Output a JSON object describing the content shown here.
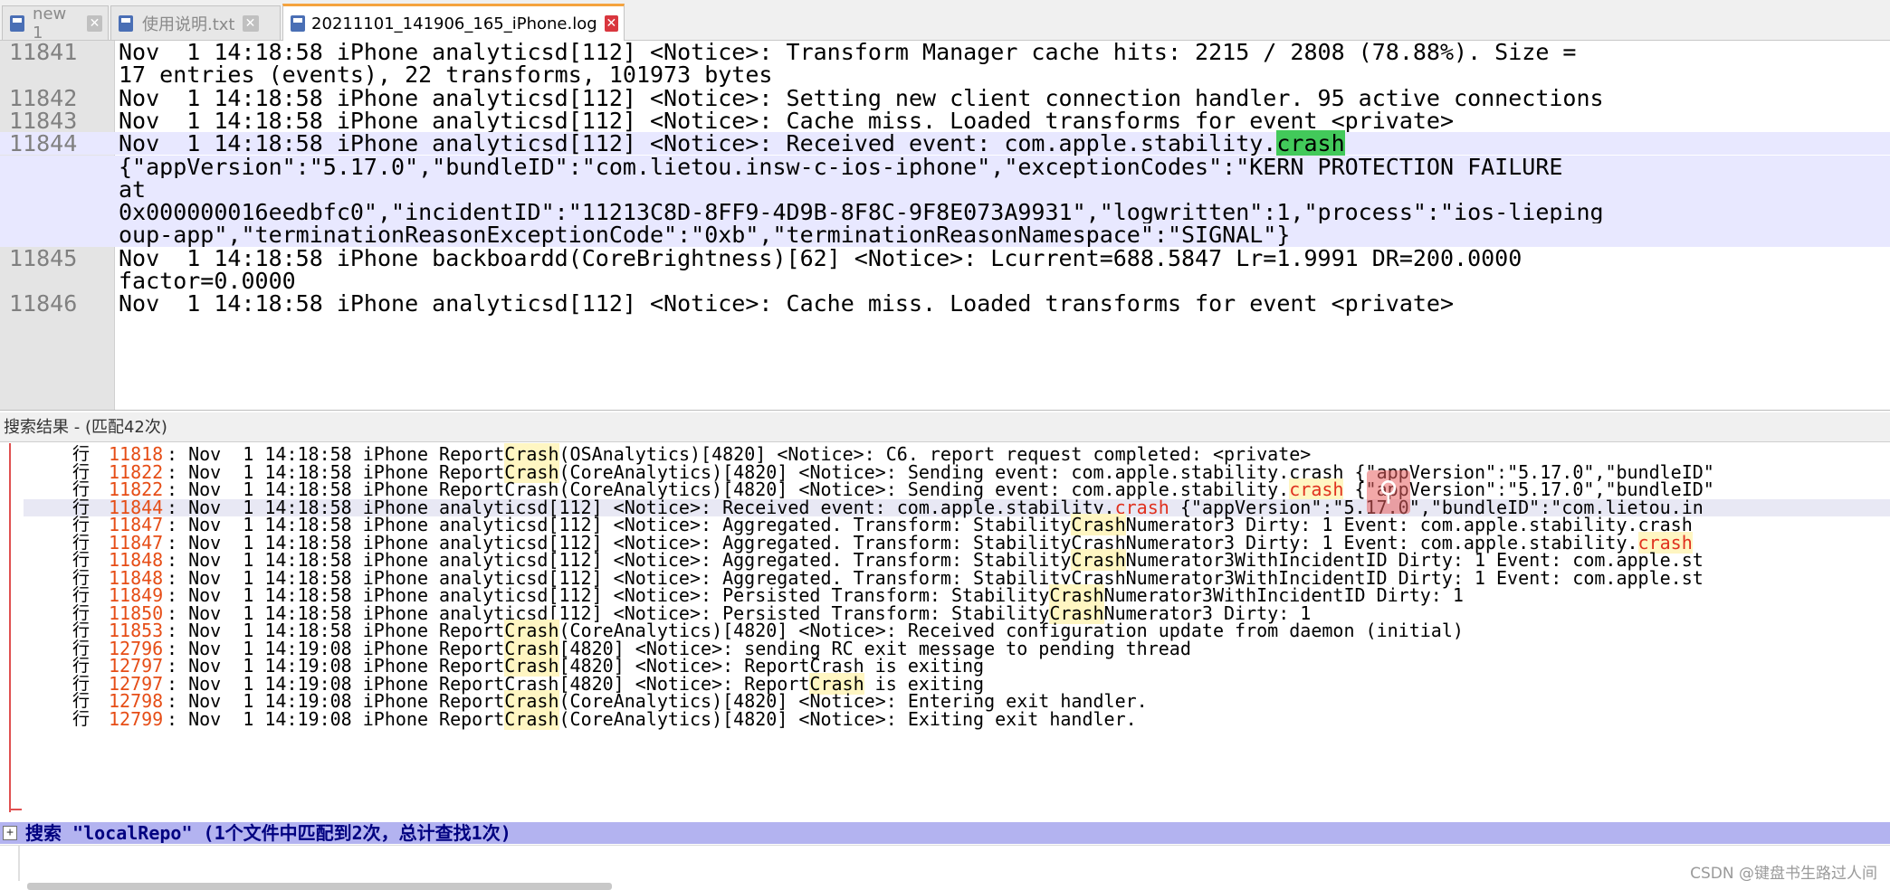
{
  "tabs": [
    {
      "label": "new 1",
      "icon": "save-disk-icon",
      "color": "#4a6fb5",
      "active": false
    },
    {
      "label": "使用说明.txt",
      "icon": "save-disk-icon",
      "color": "#4a6fb5",
      "active": false
    },
    {
      "label": "20211101_141906_165_iPhone.log",
      "icon": "save-disk-icon",
      "color": "#4a6fb5",
      "active": true
    }
  ],
  "editor": {
    "lines": [
      {
        "num": "11841",
        "text": "Nov  1 14:18:58 iPhone analyticsd[112] <Notice>: Transform Manager cache hits: 2215 / 2808 (78.88%). Size ="
      },
      {
        "num": "",
        "text": "17 entries (events), 22 transforms, 101973 bytes"
      },
      {
        "num": "11842",
        "text": "Nov  1 14:18:58 iPhone analyticsd[112] <Notice>: Setting new client connection handler. 95 active connections"
      },
      {
        "num": "11843",
        "text": "Nov  1 14:18:58 iPhone analyticsd[112] <Notice>: Cache miss. Loaded transforms for event <private>"
      },
      {
        "num": "11844",
        "text": "Nov  1 14:18:58 iPhone analyticsd[112] <Notice>: Received event: com.apple.stability.",
        "mark": "crash",
        "highlight": true
      },
      {
        "num": "",
        "text": "{\"appVersion\":\"5.17.0\",\"bundleID\":\"com.lietou.insw-c-ios-iphone\",\"exceptionCodes\":\"KERN_PROTECTION_FAILURE",
        "highlight": true
      },
      {
        "num": "",
        "text": "at",
        "highlight": true
      },
      {
        "num": "",
        "text": "0x000000016eedbfc0\",\"incidentID\":\"11213C8D-8FF9-4D9B-8F8C-9F8E073A9931\",\"logwritten\":1,\"process\":\"ios-lieping",
        "highlight": true
      },
      {
        "num": "",
        "text": "oup-app\",\"terminationReasonExceptionCode\":\"0xb\",\"terminationReasonNamespace\":\"SIGNAL\"}",
        "highlight": true
      },
      {
        "num": "11845",
        "text": "Nov  1 14:18:58 iPhone backboardd(CoreBrightness)[62] <Notice>: Lcurrent=688.5847 Lr=1.9991 DR=200.0000"
      },
      {
        "num": "",
        "text": "factor=0.0000"
      },
      {
        "num": "11846",
        "text": "Nov  1 14:18:58 iPhone analyticsd[112] <Notice>: Cache miss. Loaded transforms for event <private>"
      }
    ]
  },
  "results_header": "搜索结果 - (匹配42次)",
  "results": [
    {
      "hang": "行",
      "num": "11818",
      "pre": ": Nov  1 14:18:58 iPhone Report",
      "hit": "Crash",
      "post": "(OSAnalytics)[4820] <Notice>: C6. report request completed: <private>"
    },
    {
      "hang": "行",
      "num": "11822",
      "pre": ": Nov  1 14:18:58 iPhone Report",
      "hit": "Crash",
      "post": "(CoreAnalytics)[4820] <Notice>: Sending event: com.apple.stability.crash {\"appVersion\":\"5.17.0\",\"bundleID\""
    },
    {
      "hang": "行",
      "num": "11822",
      "pre": ": Nov  1 14:18:58 iPhone ReportCrash(CoreAnalytics)[4820] <Notice>: Sending event: com.apple.stability.",
      "hit": "crash",
      "post": " {\"appVersion\":\"5.17.0\",\"bundleID\""
    },
    {
      "hang": "行",
      "num": "11844",
      "pre": ": Nov  1 14:18:58 iPhone analyticsd[112] <Notice>: Received event: com.apple.stability.",
      "hit": "crash",
      "post": " {\"appVersion\":\"5.17.0\",\"bundleID\":\"com.lietou.in",
      "selected": true
    },
    {
      "hang": "行",
      "num": "11847",
      "pre": ": Nov  1 14:18:58 iPhone analyticsd[112] <Notice>: Aggregated. Transform: Stability",
      "hit": "Crash",
      "post": "Numerator3 Dirty: 1 Event: com.apple.stability.crash"
    },
    {
      "hang": "行",
      "num": "11847",
      "pre": ": Nov  1 14:18:58 iPhone analyticsd[112] <Notice>: Aggregated. Transform: StabilityCrashNumerator3 Dirty: 1 Event: com.apple.stability.",
      "hit": "crash",
      "post": ""
    },
    {
      "hang": "行",
      "num": "11848",
      "pre": ": Nov  1 14:18:58 iPhone analyticsd[112] <Notice>: Aggregated. Transform: Stability",
      "hit": "Crash",
      "post": "Numerator3WithIncidentID Dirty: 1 Event: com.apple.st"
    },
    {
      "hang": "行",
      "num": "11848",
      "pre": ": Nov  1 14:18:58 iPhone analyticsd[112] <Notice>: Aggregated. Transform: StabilityCrashNumerator3WithIncidentID Dirty: 1 Event: com.apple.st",
      "hit": "",
      "post": ""
    },
    {
      "hang": "行",
      "num": "11849",
      "pre": ": Nov  1 14:18:58 iPhone analyticsd[112] <Notice>: Persisted Transform: Stability",
      "hit": "Crash",
      "post": "Numerator3WithIncidentID Dirty: 1"
    },
    {
      "hang": "行",
      "num": "11850",
      "pre": ": Nov  1 14:18:58 iPhone analyticsd[112] <Notice>: Persisted Transform: Stability",
      "hit": "Crash",
      "post": "Numerator3 Dirty: 1"
    },
    {
      "hang": "行",
      "num": "11853",
      "pre": ": Nov  1 14:18:58 iPhone Report",
      "hit": "Crash",
      "post": "(CoreAnalytics)[4820] <Notice>: Received configuration update from daemon (initial)"
    },
    {
      "hang": "行",
      "num": "12796",
      "pre": ": Nov  1 14:19:08 iPhone Report",
      "hit": "Crash",
      "post": "[4820] <Notice>: sending RC exit message to pending thread"
    },
    {
      "hang": "行",
      "num": "12797",
      "pre": ": Nov  1 14:19:08 iPhone Report",
      "hit": "Crash",
      "post": "[4820] <Notice>: ReportCrash is exiting"
    },
    {
      "hang": "行",
      "num": "12797",
      "pre": ": Nov  1 14:19:08 iPhone ReportCrash[4820] <Notice>: Report",
      "hit": "Crash",
      "post": " is exiting"
    },
    {
      "hang": "行",
      "num": "12798",
      "pre": ": Nov  1 14:19:08 iPhone Report",
      "hit": "Crash",
      "post": "(CoreAnalytics)[4820] <Notice>: Entering exit handler."
    },
    {
      "hang": "行",
      "num": "12799",
      "pre": ": Nov  1 14:19:08 iPhone Report",
      "hit": "Crash",
      "post": "(CoreAnalytics)[4820] <Notice>: Exiting exit handler."
    }
  ],
  "summary": {
    "expander": "+",
    "text": "搜索 \"localRepo\" (1个文件中匹配到2次，总计查找1次)"
  },
  "watermark": "CSDN @键盘书生路过人间",
  "zoom_glyph": "⚲",
  "colors": {
    "tab_accent": "#f5a33e",
    "close_active": "#d9363e",
    "match_mark": "#42c95a",
    "hit_text": "#e0301e",
    "line_number_result": "#e64d16",
    "summary_bg": "#b3b3f0"
  }
}
